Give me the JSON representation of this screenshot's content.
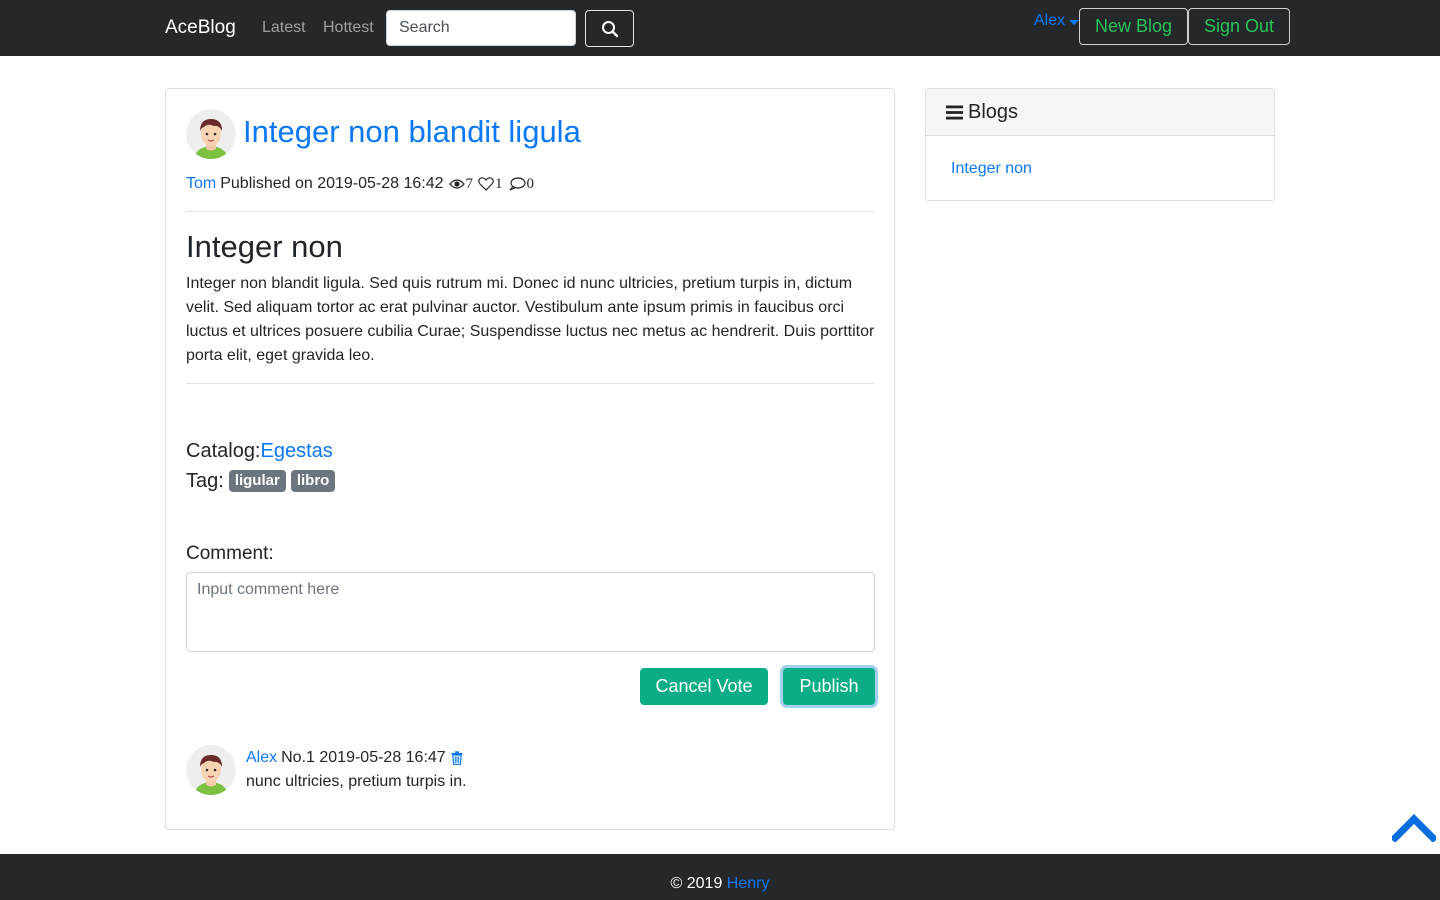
{
  "navbar": {
    "brand": "AceBlog",
    "links": [
      "Latest",
      "Hottest"
    ],
    "search_placeholder": "Search",
    "user_name": "Alex",
    "new_blog_label": "New Blog",
    "sign_out_label": "Sign Out"
  },
  "post": {
    "title": "Integer non blandit ligula",
    "author": "Tom",
    "published_text": "Published on 2019-05-28 16:42",
    "views": "7",
    "likes": "1",
    "comments": "0",
    "heading": "Integer non",
    "body": "Integer non blandit ligula. Sed quis rutrum mi. Donec id nunc ultricies, pretium turpis in, dictum velit. Sed aliquam tortor ac erat pulvinar auctor. Vestibulum ante ipsum primis in faucibus orci luctus et ultrices posuere cubilia Curae; Suspendisse luctus nec metus ac hendrerit. Duis porttitor porta elit, eget gravida leo.",
    "catalog_label": "Catalog:",
    "catalog_value": "Egestas",
    "tag_label": "Tag:",
    "tags": [
      "ligular",
      "libro"
    ]
  },
  "comment_form": {
    "label": "Comment:",
    "placeholder": "Input comment here",
    "cancel_vote_label": "Cancel Vote",
    "publish_label": "Publish"
  },
  "comments": [
    {
      "author": "Alex",
      "meta": "No.1 2019-05-28 16:47",
      "text": "nunc ultricies, pretium turpis in."
    }
  ],
  "sidebar": {
    "title": "Blogs",
    "items": [
      "Integer non"
    ]
  },
  "footer": {
    "copyright": "© 2019",
    "author_link": "Henry"
  },
  "colors": {
    "navbar_bg": "#24282b",
    "link": "#0b78f5",
    "success_outline": "#28c257",
    "teal_button": "#0aad85",
    "badge": "#6c757d"
  }
}
